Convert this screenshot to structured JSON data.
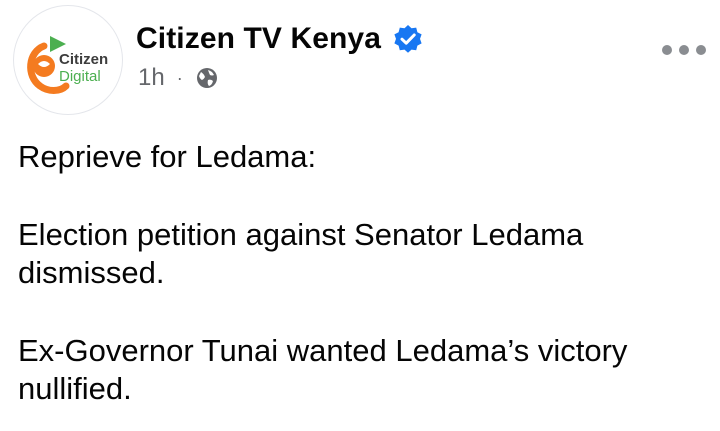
{
  "post": {
    "author": {
      "name": "Citizen TV Kenya",
      "avatar_text_line1": "Citizen",
      "avatar_text_line2": "Digital",
      "verified_icon": "verified-badge-icon"
    },
    "meta": {
      "time": "1h",
      "separator": "·",
      "audience_icon": "globe-icon"
    },
    "more_icon": "more-options-icon",
    "paragraphs": [
      "Reprieve for Ledama:",
      "Election petition against Senator Ledama dismissed.",
      "Ex-Governor Tunai wanted Ledama’s victory nullified."
    ]
  },
  "colors": {
    "text": "#050505",
    "secondary_text": "#65676b",
    "verified_blue": "#1877f2",
    "brand_orange": "#f47b20",
    "brand_green": "#4caf50",
    "brand_grey": "#3d3d3d"
  }
}
